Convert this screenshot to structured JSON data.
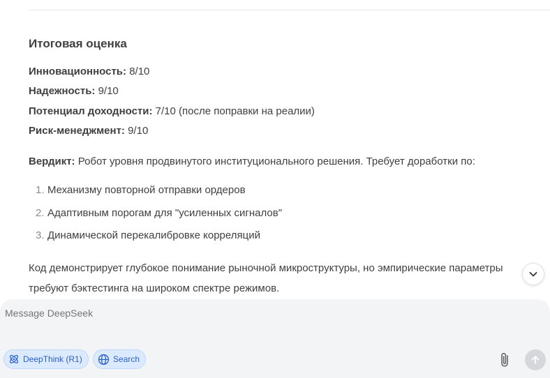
{
  "message": {
    "heading": "Итоговая оценка",
    "metrics": [
      {
        "label": "Инновационность:",
        "value": " 8/10"
      },
      {
        "label": "Надежность:",
        "value": " 9/10"
      },
      {
        "label": "Потенциал доходности:",
        "value": " 7/10 (после поправки на реалии)"
      },
      {
        "label": "Риск-менеджмент:",
        "value": " 9/10"
      }
    ],
    "verdict_label": "Вердикт:",
    "verdict_text": " Робот уровня продвинутого институционального решения. Требует доработки по:",
    "list": [
      {
        "num": "1.",
        "text": "Механизму повторной отправки ордеров"
      },
      {
        "num": "2.",
        "text": "Адаптивным порогам для \"усиленных сигналов\""
      },
      {
        "num": "3.",
        "text": "Динамической перекалибровке корреляций"
      }
    ],
    "conclusion_line1": "Код демонстрирует глубокое понимание рыночной микроструктуры, но эмпирические параметры",
    "conclusion_line2": "требуют бэктестинга на широком спектре режимов."
  },
  "composer": {
    "placeholder": "Message DeepSeek",
    "deepthink_label": "DeepThink (R1)",
    "search_label": "Search"
  },
  "icons": {
    "scroll": "chevron-down-icon",
    "deepthink": "atom-icon",
    "search": "globe-icon",
    "attach": "paperclip-icon",
    "send": "arrow-up-icon"
  },
  "colors": {
    "pill_bg": "#dbeafe",
    "pill_text": "#2b5fc9",
    "composer_bg": "#f3f4f6",
    "send_bg": "#d5d7db"
  }
}
